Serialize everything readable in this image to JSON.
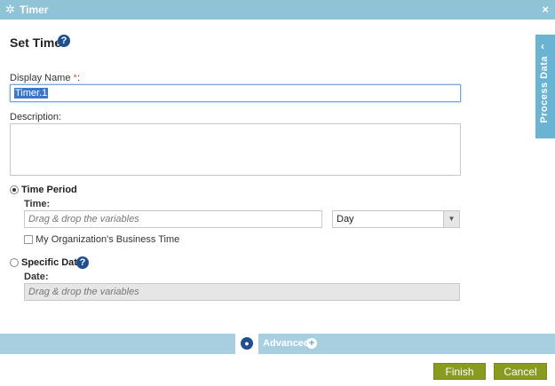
{
  "window": {
    "title": "Timer",
    "close_label": "×"
  },
  "header": {
    "heading": "Set Time",
    "help_glyph": "?"
  },
  "display_name": {
    "label": "Display Name ",
    "required_mark": "*",
    "colon": ":",
    "value": "Timer.1"
  },
  "description": {
    "label": "Description:",
    "value": ""
  },
  "time_period": {
    "label": "Time Period",
    "selected": true,
    "time_label": "Time:",
    "time_placeholder": "Drag & drop the variables",
    "unit_value": "Day",
    "business_time_label": "My Organization's Business Time",
    "business_time_checked": false
  },
  "specific_date": {
    "label": "Specific Date",
    "selected": false,
    "date_label": "Date:",
    "date_placeholder": "Drag & drop the variables"
  },
  "side_panel": {
    "label": "Process Data",
    "chevron": "‹"
  },
  "advanced": {
    "label": "Advanced",
    "plus": "+"
  },
  "footer": {
    "finish_label": "Finish",
    "cancel_label": "Cancel"
  },
  "colors": {
    "title_bar": "#8fc3d6",
    "side_tab": "#6ab3d3",
    "advanced_bar": "#a8cfdf",
    "button": "#8b9a20",
    "help_icon": "#1e4f8f"
  }
}
